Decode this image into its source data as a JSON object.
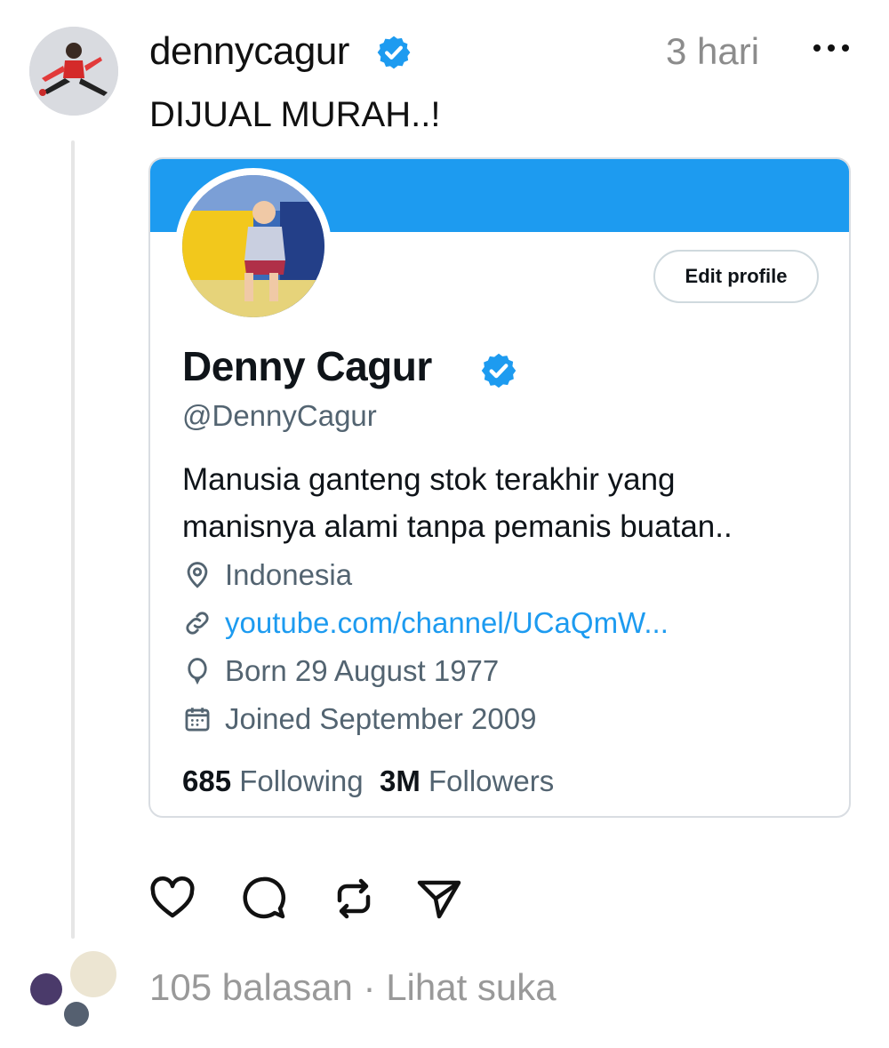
{
  "post": {
    "username": "dennycagur",
    "time": "3 hari",
    "text": "DIJUAL MURAH..!"
  },
  "card": {
    "edit_button": "Edit profile",
    "name": "Denny Cagur",
    "handle": "@DennyCagur",
    "bio_line1": "Manusia ganteng stok terakhir yang",
    "bio_line2": "manisnya alami tanpa pemanis buatan..",
    "location": "Indonesia",
    "link": "youtube.com/channel/UCaQmW...",
    "born": "Born 29 August 1977",
    "joined": "Joined September 2009",
    "following_count": "685",
    "following_label": "Following",
    "followers_count": "3M",
    "followers_label": "Followers"
  },
  "footer": {
    "replies": "105 balasan · Lihat suka"
  },
  "colors": {
    "accent": "#1d9bf0",
    "verified": "#1d9bf0",
    "muted": "#536471"
  },
  "icons": [
    "more-icon",
    "verified-icon",
    "location-icon",
    "link-icon",
    "balloon-icon",
    "calendar-icon",
    "heart-icon",
    "comment-icon",
    "repost-icon",
    "share-icon"
  ]
}
